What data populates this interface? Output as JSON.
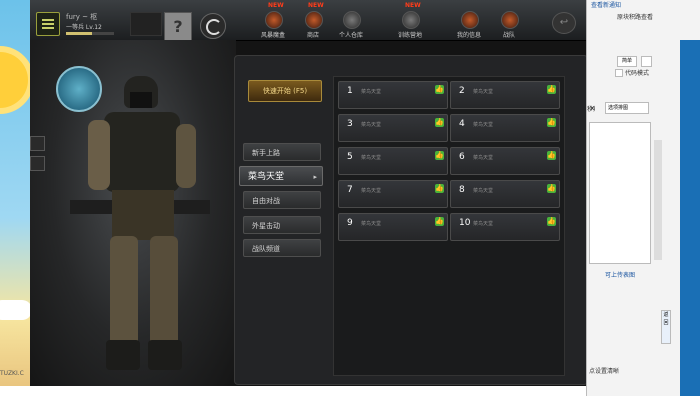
{
  "desktop": {
    "label": "TUZKI.C"
  },
  "game": {
    "title_text": "...",
    "user": {
      "name": "fury ~ 枢",
      "rank": "一等兵 Lv.12",
      "xp_fraction": 0.55
    },
    "nav": [
      {
        "label": "风暴魔盒",
        "new": "NEW"
      },
      {
        "label": "商店",
        "new": "NEW"
      },
      {
        "label": "个人仓库",
        "new": ""
      },
      {
        "label": "训练营地",
        "new": "NEW"
      },
      {
        "label": "我的信息",
        "new": ""
      },
      {
        "label": "战队",
        "new": ""
      }
    ],
    "quick_start": "快速开始 (F5)",
    "modes": [
      {
        "label": "新手上路"
      },
      {
        "label": "菜鸟天堂",
        "arrow": "▸"
      },
      {
        "label": "自由对战"
      },
      {
        "label": "外星击动"
      },
      {
        "label": "战队频道"
      }
    ],
    "rooms": [
      {
        "num": "1",
        "name": "菜鸟天堂"
      },
      {
        "num": "2",
        "name": "菜鸟天堂"
      },
      {
        "num": "3",
        "name": "菜鸟天堂"
      },
      {
        "num": "4",
        "name": "菜鸟天堂"
      },
      {
        "num": "5",
        "name": "菜鸟天堂"
      },
      {
        "num": "6",
        "name": "菜鸟天堂"
      },
      {
        "num": "7",
        "name": "菜鸟天堂"
      },
      {
        "num": "8",
        "name": "菜鸟天堂"
      },
      {
        "num": "9",
        "name": "菜鸟天堂"
      },
      {
        "num": "10",
        "name": "菜鸟天堂"
      }
    ],
    "thumb_icon": "👍"
  },
  "browser_panel": {
    "line1": "查看新通知",
    "line2": "原块积路查看",
    "btn_simple": "简单",
    "code_mode": "代码模式",
    "prefix": "秒)",
    "select_placeholder": "选项排图",
    "close": "✕",
    "upload_link": "可上传表图",
    "side_tab": "返回",
    "bottom_text": "点设置清晰"
  }
}
